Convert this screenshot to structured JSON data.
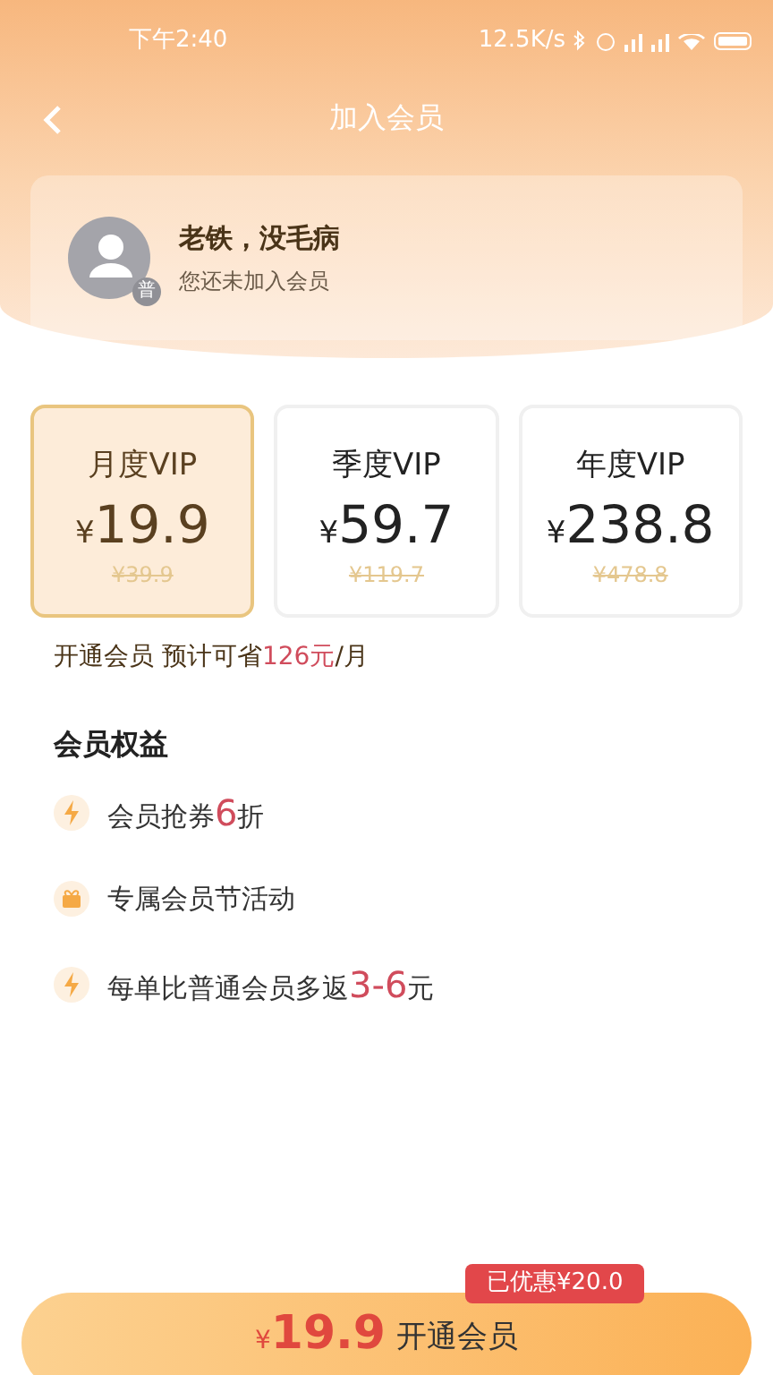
{
  "status_bar": {
    "time": "下午2:40",
    "speed": "12.5K/s"
  },
  "nav": {
    "title": "加入会员"
  },
  "profile": {
    "name": "老铁，没毛病",
    "badge": "普",
    "status": "您还未加入会员"
  },
  "plans": [
    {
      "name": "月度VIP",
      "currency": "¥",
      "price": "19.9",
      "original": "¥39.9",
      "selected": true
    },
    {
      "name": "季度VIP",
      "currency": "¥",
      "price": "59.7",
      "original": "¥119.7",
      "selected": false
    },
    {
      "name": "年度VIP",
      "currency": "¥",
      "price": "238.8",
      "original": "¥478.8",
      "selected": false
    }
  ],
  "savings": {
    "prefix": "开通会员 预计可省",
    "highlight": "126元",
    "suffix": "/月"
  },
  "benefits": {
    "title": "会员权益",
    "items": [
      {
        "kind": "bolt",
        "text": "会员抢券",
        "highlight": "6",
        "suffix": "折"
      },
      {
        "kind": "gift",
        "text": "专属会员节活动"
      },
      {
        "kind": "bolt",
        "text": "每单比普通会员多返",
        "highlight": "3-6",
        "suffix": "元"
      }
    ]
  },
  "footer": {
    "badge": "已优惠¥20.0",
    "currency": "¥",
    "price": "19.9",
    "label": "开通会员"
  }
}
